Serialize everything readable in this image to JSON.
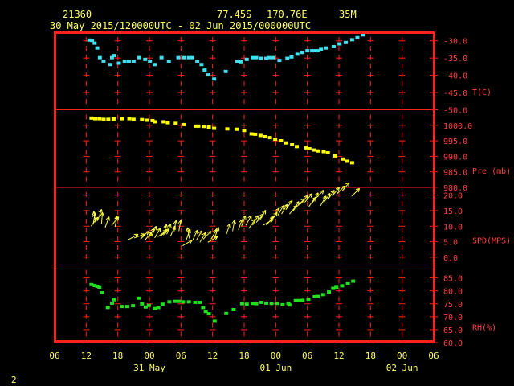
{
  "header": {
    "station_id": "21360",
    "latitude": "77.45S",
    "longitude": "170.76E",
    "elevation": "35M",
    "time_range": "30 May 2015/120000UTC - 02 Jun 2015/000000UTC"
  },
  "footer": {
    "page_number": "2"
  },
  "colors": {
    "frame": "#ff2020",
    "grid": "#ff2020",
    "labels": "#ff4040",
    "text": "#ffff66",
    "temperature": "#40e0f0",
    "pressure": "#ffff00",
    "wind": "#ffff40",
    "humidity": "#20e020"
  },
  "chart_data": {
    "type": "scatter",
    "x_axis": {
      "unit": "hours since 30 May 2015 06:00 UTC",
      "range": [
        0,
        72
      ],
      "tick_labels": [
        "06",
        "12",
        "18",
        "00",
        "06",
        "12",
        "18",
        "00",
        "06",
        "12",
        "18",
        "00",
        "06"
      ],
      "date_labels": [
        {
          "text": "31 May",
          "at_label": "00"
        },
        {
          "text": "01 Jun",
          "at_label": "00"
        },
        {
          "text": "02 Jun",
          "at_label": "00"
        }
      ]
    },
    "panels": [
      {
        "name": "temperature",
        "label": "T(C)",
        "ticks": [
          -30,
          -35,
          -40,
          -45,
          -50
        ],
        "tick_labels": [
          "-30.0",
          "-35.0",
          "-40.0",
          "-45.0",
          "-50.0"
        ],
        "range": [
          -50,
          -27.5
        ],
        "marker": "square",
        "points": [
          [
            6.6,
            -29.9
          ],
          [
            7.1,
            -30.0
          ],
          [
            7.6,
            -30.8
          ],
          [
            8.1,
            -32.2
          ],
          [
            8.6,
            -35.0
          ],
          [
            9.3,
            -36.0
          ],
          [
            10.6,
            -37.0
          ],
          [
            10.9,
            -35.0
          ],
          [
            11.3,
            -34.4
          ],
          [
            12.2,
            -36.6
          ],
          [
            13.3,
            -36.0
          ],
          [
            14.1,
            -36.0
          ],
          [
            15.0,
            -36.0
          ],
          [
            16.1,
            -35.0
          ],
          [
            17.2,
            -35.5
          ],
          [
            18.1,
            -36.0
          ],
          [
            19.0,
            -37.0
          ],
          [
            20.3,
            -35.0
          ],
          [
            21.7,
            -36.0
          ],
          [
            23.5,
            -35.0
          ],
          [
            24.6,
            -35.0
          ],
          [
            25.5,
            -35.0
          ],
          [
            26.1,
            -35.0
          ],
          [
            27.1,
            -36.0
          ],
          [
            27.9,
            -37.0
          ],
          [
            28.5,
            -38.6
          ],
          [
            29.2,
            -40.0
          ],
          [
            30.3,
            -41.2
          ],
          [
            32.5,
            -39.0
          ],
          [
            34.7,
            -36.0
          ],
          [
            35.3,
            -36.2
          ],
          [
            36.5,
            -35.5
          ],
          [
            37.6,
            -35.0
          ],
          [
            38.3,
            -35.0
          ],
          [
            39.2,
            -35.2
          ],
          [
            40.2,
            -35.2
          ],
          [
            40.7,
            -35.0
          ],
          [
            41.5,
            -35.0
          ],
          [
            42.7,
            -35.8
          ],
          [
            44.2,
            -35.2
          ],
          [
            45.0,
            -34.8
          ],
          [
            46.1,
            -34.0
          ],
          [
            47.0,
            -33.5
          ],
          [
            48.0,
            -33.0
          ],
          [
            48.9,
            -33.0
          ],
          [
            49.3,
            -33.0
          ],
          [
            50.0,
            -33.0
          ],
          [
            50.6,
            -32.6
          ],
          [
            51.6,
            -32.2
          ],
          [
            53.0,
            -31.8
          ],
          [
            54.1,
            -31.0
          ],
          [
            55.3,
            -30.6
          ],
          [
            56.5,
            -29.8
          ],
          [
            57.5,
            -29.2
          ],
          [
            58.6,
            -28.4
          ]
        ]
      },
      {
        "name": "pressure",
        "label": "Pre (mb)",
        "ticks": [
          1000,
          995,
          990,
          985,
          980
        ],
        "tick_labels": [
          "1000.0",
          "995.0",
          "990.0",
          "985.0",
          "980.0"
        ],
        "range": [
          980,
          1005
        ],
        "marker": "square",
        "points": [
          [
            7.0,
            1002.2
          ],
          [
            7.7,
            1002.0
          ],
          [
            8.5,
            1002.0
          ],
          [
            9.3,
            1001.8
          ],
          [
            10.2,
            1001.8
          ],
          [
            11.2,
            1001.9
          ],
          [
            12.8,
            1002.0
          ],
          [
            14.2,
            1002.0
          ],
          [
            15.0,
            1001.8
          ],
          [
            16.6,
            1001.7
          ],
          [
            17.5,
            1001.5
          ],
          [
            18.6,
            1001.4
          ],
          [
            19.1,
            1001.0
          ],
          [
            20.7,
            1001.0
          ],
          [
            21.5,
            1000.7
          ],
          [
            23.0,
            1000.5
          ],
          [
            24.6,
            1000.1
          ],
          [
            26.8,
            999.6
          ],
          [
            27.3,
            999.6
          ],
          [
            28.3,
            999.5
          ],
          [
            29.3,
            999.3
          ],
          [
            30.3,
            998.9
          ],
          [
            32.8,
            998.7
          ],
          [
            34.6,
            998.6
          ],
          [
            36.0,
            998.2
          ],
          [
            37.4,
            997.1
          ],
          [
            38.1,
            997.0
          ],
          [
            39.1,
            996.6
          ],
          [
            40.0,
            996.2
          ],
          [
            40.9,
            995.9
          ],
          [
            41.9,
            995.4
          ],
          [
            43.0,
            994.9
          ],
          [
            44.0,
            994.2
          ],
          [
            45.1,
            993.6
          ],
          [
            46.0,
            993.0
          ],
          [
            47.8,
            992.6
          ],
          [
            48.4,
            992.3
          ],
          [
            49.3,
            991.9
          ],
          [
            50.1,
            991.6
          ],
          [
            51.1,
            991.4
          ],
          [
            51.9,
            991.0
          ],
          [
            53.3,
            990.0
          ],
          [
            54.8,
            989.0
          ],
          [
            55.6,
            988.3
          ],
          [
            56.5,
            987.8
          ]
        ]
      },
      {
        "name": "wind",
        "label": "SPD(MPS)",
        "ticks": [
          20,
          15,
          10,
          5,
          0
        ],
        "tick_labels": [
          "20.0",
          "15.0",
          "10.0",
          "5.0",
          "0.0"
        ],
        "range": [
          -2.5,
          22.5
        ],
        "marker": "arrow",
        "points": [
          [
            6.9,
            10.0,
            38
          ],
          [
            7.3,
            10.5,
            10
          ],
          [
            7.8,
            11.2,
            350
          ],
          [
            8.2,
            12.0,
            20
          ],
          [
            8.9,
            10.8,
            5
          ],
          [
            9.6,
            9.6,
            20
          ],
          [
            10.8,
            10.2,
            40
          ],
          [
            11.5,
            9.8,
            10
          ],
          [
            14.0,
            5.6,
            60
          ],
          [
            15.1,
            6.2,
            70
          ],
          [
            16.3,
            5.8,
            45
          ],
          [
            17.1,
            5.4,
            40
          ],
          [
            17.8,
            6.1,
            30
          ],
          [
            18.4,
            6.7,
            25
          ],
          [
            19.0,
            6.2,
            30
          ],
          [
            19.6,
            6.6,
            55
          ],
          [
            20.1,
            6.8,
            50
          ],
          [
            20.7,
            7.1,
            15
          ],
          [
            21.3,
            7.4,
            20
          ],
          [
            22.0,
            6.8,
            25
          ],
          [
            22.7,
            8.3,
            10
          ],
          [
            23.6,
            8.4,
            10
          ],
          [
            24.3,
            3.7,
            60
          ],
          [
            25.0,
            5.6,
            20
          ],
          [
            25.6,
            6.0,
            350
          ],
          [
            26.2,
            5.4,
            25
          ],
          [
            26.9,
            5.4,
            30
          ],
          [
            27.6,
            4.8,
            30
          ],
          [
            28.2,
            5.8,
            45
          ],
          [
            29.1,
            4.8,
            60
          ],
          [
            29.7,
            5.8,
            30
          ],
          [
            30.4,
            6.3,
            20
          ],
          [
            32.6,
            7.4,
            20
          ],
          [
            33.8,
            8.4,
            10
          ],
          [
            34.9,
            8.8,
            20
          ],
          [
            35.5,
            10.0,
            20
          ],
          [
            36.3,
            10.3,
            30
          ],
          [
            36.9,
            9.3,
            35
          ],
          [
            37.6,
            10.3,
            30
          ],
          [
            38.3,
            11.2,
            40
          ],
          [
            39.0,
            12.0,
            30
          ],
          [
            39.6,
            10.3,
            60
          ],
          [
            40.2,
            10.3,
            40
          ],
          [
            40.9,
            11.6,
            40
          ],
          [
            41.6,
            12.7,
            30
          ],
          [
            42.4,
            13.5,
            30
          ],
          [
            43.1,
            13.9,
            30
          ],
          [
            43.9,
            15.3,
            35
          ],
          [
            44.6,
            13.9,
            40
          ],
          [
            45.3,
            14.8,
            30
          ],
          [
            46.0,
            16.3,
            45
          ],
          [
            46.7,
            17.1,
            40
          ],
          [
            47.5,
            17.7,
            40
          ],
          [
            48.3,
            16.3,
            35
          ],
          [
            49.0,
            17.6,
            30
          ],
          [
            49.6,
            19.0,
            45
          ],
          [
            50.5,
            16.6,
            30
          ],
          [
            51.1,
            17.6,
            35
          ],
          [
            51.9,
            18.6,
            35
          ],
          [
            52.7,
            19.7,
            40
          ],
          [
            53.6,
            20.4,
            45
          ],
          [
            54.6,
            21.3,
            40
          ],
          [
            56.4,
            19.6,
            45
          ]
        ]
      },
      {
        "name": "humidity",
        "label": "RH(%)",
        "ticks": [
          85,
          80,
          75,
          70,
          65,
          60
        ],
        "tick_labels": [
          "85.0",
          "80.0",
          "75.0",
          "70.0",
          "65.0",
          "60.0"
        ],
        "range": [
          60,
          90
        ],
        "marker": "square",
        "points": [
          [
            7.0,
            82.3
          ],
          [
            7.6,
            81.9
          ],
          [
            8.1,
            81.6
          ],
          [
            8.5,
            81.1
          ],
          [
            9.0,
            79.1
          ],
          [
            10.1,
            73.4
          ],
          [
            10.9,
            75.1
          ],
          [
            11.3,
            76.4
          ],
          [
            12.8,
            73.8
          ],
          [
            13.8,
            73.8
          ],
          [
            14.9,
            74.1
          ],
          [
            16.0,
            77.0
          ],
          [
            16.6,
            74.8
          ],
          [
            17.3,
            73.6
          ],
          [
            17.9,
            74.2
          ],
          [
            19.0,
            73.0
          ],
          [
            19.7,
            73.4
          ],
          [
            20.5,
            74.7
          ],
          [
            21.8,
            75.6
          ],
          [
            22.9,
            75.8
          ],
          [
            23.6,
            75.8
          ],
          [
            24.4,
            75.6
          ],
          [
            25.5,
            75.6
          ],
          [
            26.7,
            75.4
          ],
          [
            27.6,
            75.4
          ],
          [
            28.2,
            73.4
          ],
          [
            28.7,
            71.9
          ],
          [
            29.3,
            71.0
          ],
          [
            30.4,
            68.1
          ],
          [
            32.6,
            71.1
          ],
          [
            34.0,
            72.6
          ],
          [
            35.6,
            74.9
          ],
          [
            36.5,
            74.7
          ],
          [
            37.6,
            75.0
          ],
          [
            38.3,
            74.9
          ],
          [
            39.3,
            75.4
          ],
          [
            40.2,
            75.1
          ],
          [
            41.2,
            75.0
          ],
          [
            42.3,
            75.0
          ],
          [
            43.3,
            74.5
          ],
          [
            44.4,
            75.0
          ],
          [
            44.6,
            74.4
          ],
          [
            45.8,
            76.1
          ],
          [
            46.5,
            76.1
          ],
          [
            47.1,
            76.2
          ],
          [
            48.2,
            76.6
          ],
          [
            49.4,
            77.6
          ],
          [
            50.0,
            77.7
          ],
          [
            51.0,
            78.4
          ],
          [
            52.1,
            79.4
          ],
          [
            52.9,
            80.8
          ],
          [
            53.5,
            81.2
          ],
          [
            54.6,
            81.8
          ],
          [
            55.7,
            82.6
          ],
          [
            56.7,
            83.6
          ]
        ]
      }
    ]
  }
}
